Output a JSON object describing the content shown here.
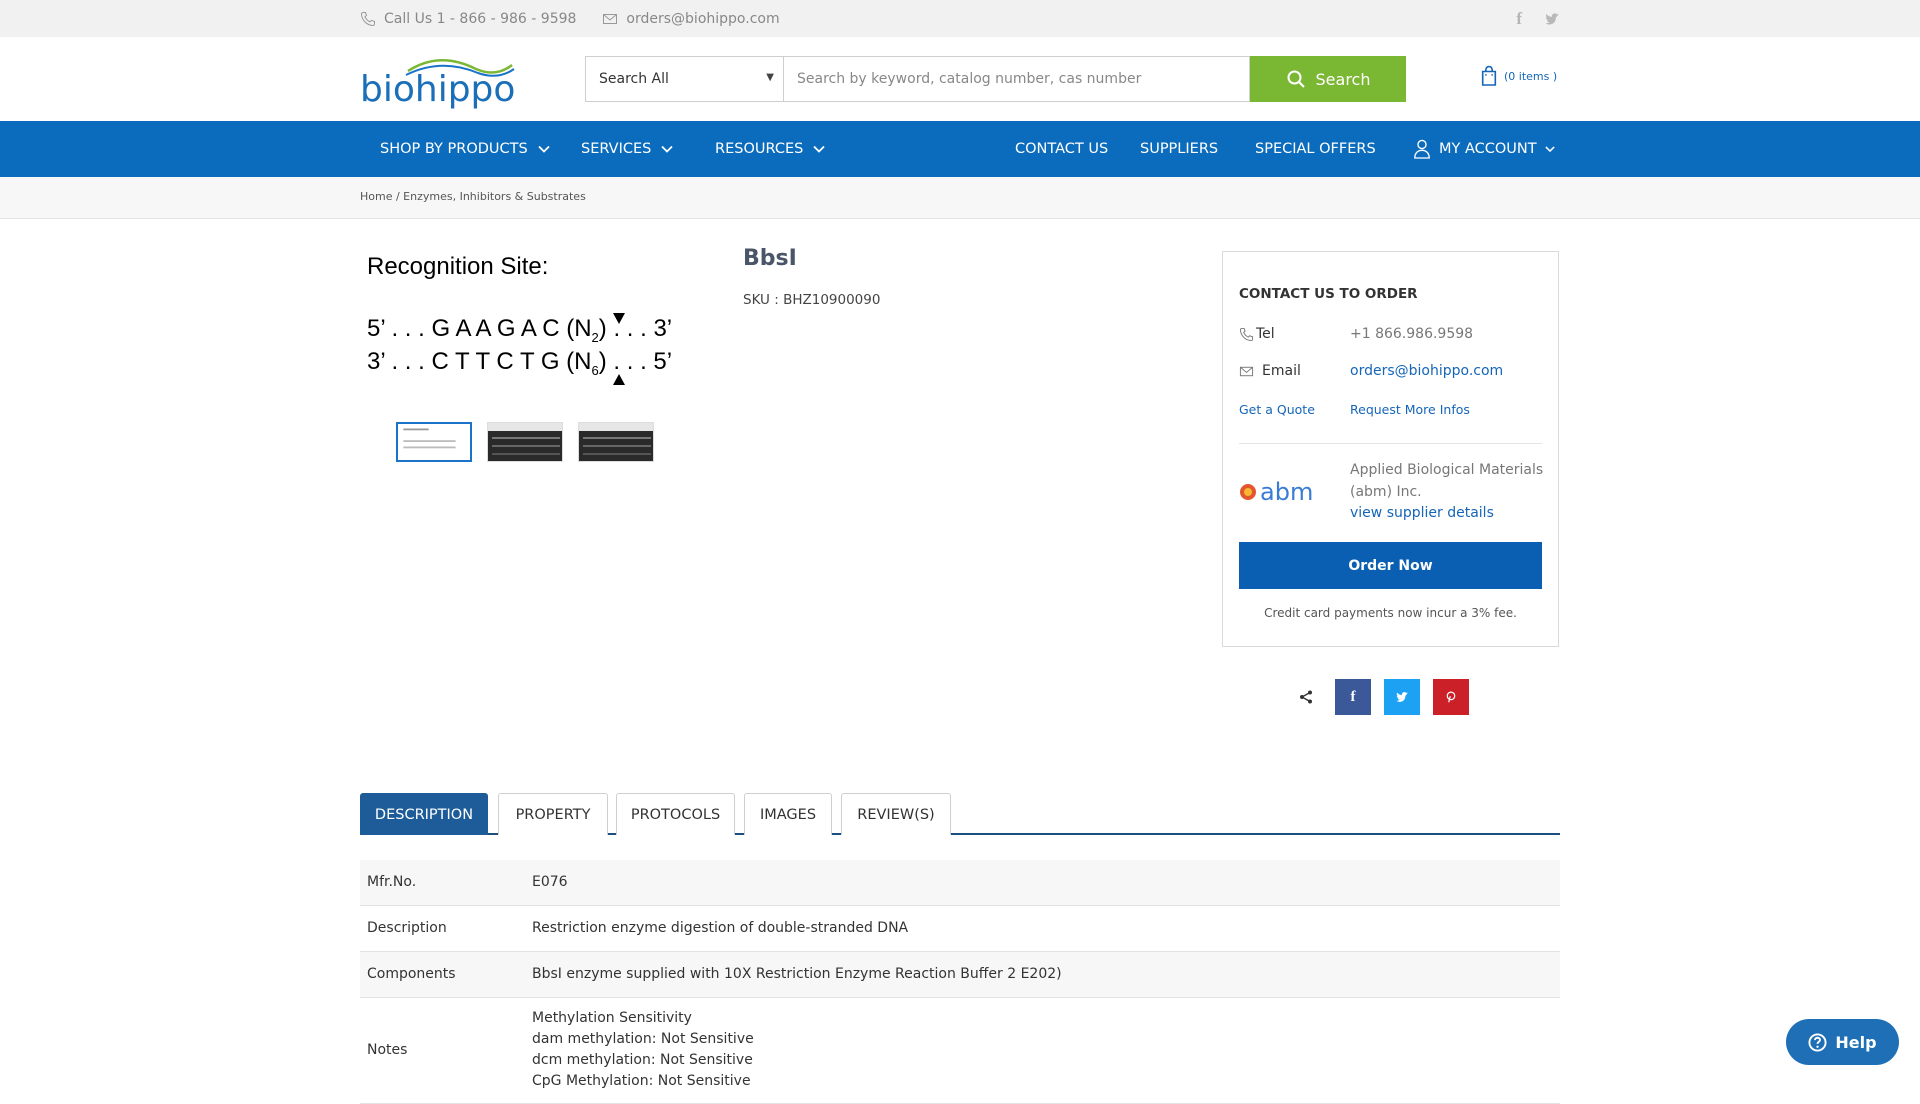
{
  "topbar": {
    "phone": "Call Us 1 - 866 - 986 - 9598",
    "email": "orders@biohippo.com",
    "social": [
      "facebook-icon",
      "twitter-icon"
    ]
  },
  "header": {
    "logo_text": "biohippo",
    "search": {
      "category": "Search All",
      "placeholder": "Search by keyword, catalog number, cas number",
      "button_label": "Search"
    },
    "cart_label": "(0 items )"
  },
  "nav": {
    "left": [
      {
        "label": "SHOP BY PRODUCTS"
      },
      {
        "label": "SERVICES"
      },
      {
        "label": "RESOURCES"
      }
    ],
    "right": [
      {
        "label": "CONTACT US"
      },
      {
        "label": "SUPPLIERS"
      },
      {
        "label": "SPECIAL OFFERS"
      },
      {
        "label": "MY ACCOUNT"
      }
    ]
  },
  "breadcrumb": "Home / Enzymes, Inhibitors & Substrates",
  "product": {
    "image": {
      "title": "Recognition Site:",
      "line1": {
        "prefix": "5’ . . . G A A G A C (N",
        "sub": "2",
        "suffix": ") . . . 3’"
      },
      "line2": {
        "prefix": "3’ . . . C T T C T G (N",
        "sub": "6",
        "suffix": ") . . . 5’"
      }
    },
    "title": "BbsI",
    "sku": "SKU : BHZ10900090"
  },
  "order_box": {
    "heading": "CONTACT US TO ORDER",
    "tel_label": "Tel",
    "tel_value": "+1 866.986.9598",
    "email_label": "Email",
    "email_value": "orders@biohippo.com",
    "quote_link": "Get a Quote",
    "info_link": "Request More Infos",
    "supplier_logo_text": "abm",
    "supplier_name": "Applied Biological Materials (abm) Inc.",
    "supplier_link": "view supplier details",
    "order_button": "Order Now",
    "fee_note": "Credit card payments now incur a 3% fee."
  },
  "share": {
    "icons": [
      "share-icon",
      "facebook-icon",
      "twitter-icon",
      "pinterest-icon"
    ],
    "colors": {
      "facebook": "#3b5998",
      "twitter": "#1da1f2",
      "pinterest": "#cb2027"
    }
  },
  "tabs": [
    "DESCRIPTION",
    "PROPERTY",
    "PROTOCOLS",
    "IMAGES",
    "REVIEW(S)"
  ],
  "specs": [
    {
      "key": "Mfr.No.",
      "value": "E076"
    },
    {
      "key": "Description",
      "value": "Restriction enzyme digestion of double-stranded DNA"
    },
    {
      "key": "Components",
      "value": "BbsI enzyme supplied with 10X Restriction Enzyme Reaction Buffer 2 E202)"
    },
    {
      "key": "Notes",
      "lines": [
        "Methylation Sensitivity",
        "dam methylation: Not Sensitive",
        "dcm methylation: Not Sensitive",
        "CpG Methylation: Not Sensitive"
      ]
    }
  ],
  "help_label": "Help",
  "colors": {
    "brand_blue": "#0b6cbd",
    "search_green": "#7ab833",
    "order_blue": "#0b5fb3",
    "tab_active": "#1d5c99"
  }
}
